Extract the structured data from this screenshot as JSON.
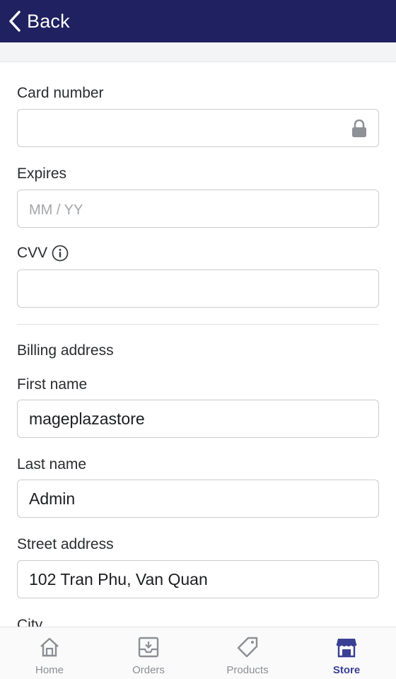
{
  "header": {
    "back_label": "Back"
  },
  "form": {
    "card_number": {
      "label": "Card number",
      "value": "",
      "placeholder": ""
    },
    "expires": {
      "label": "Expires",
      "value": "",
      "placeholder": "MM / YY"
    },
    "cvv": {
      "label": "CVV",
      "value": "",
      "placeholder": ""
    },
    "billing_heading": "Billing address",
    "first_name": {
      "label": "First name",
      "value": "mageplazastore"
    },
    "last_name": {
      "label": "Last name",
      "value": "Admin"
    },
    "street_address": {
      "label": "Street address",
      "value": "102 Tran Phu, Van Quan"
    },
    "city": {
      "label": "City"
    }
  },
  "nav": {
    "items": [
      {
        "label": "Home",
        "icon": "home-icon"
      },
      {
        "label": "Orders",
        "icon": "orders-icon"
      },
      {
        "label": "Products",
        "icon": "products-tag-icon"
      },
      {
        "label": "Store",
        "icon": "store-icon",
        "active": true
      }
    ],
    "active_color": "#3a3f94",
    "inactive_color": "#8b8e94"
  },
  "colors": {
    "header_bg": "#1f2160"
  }
}
